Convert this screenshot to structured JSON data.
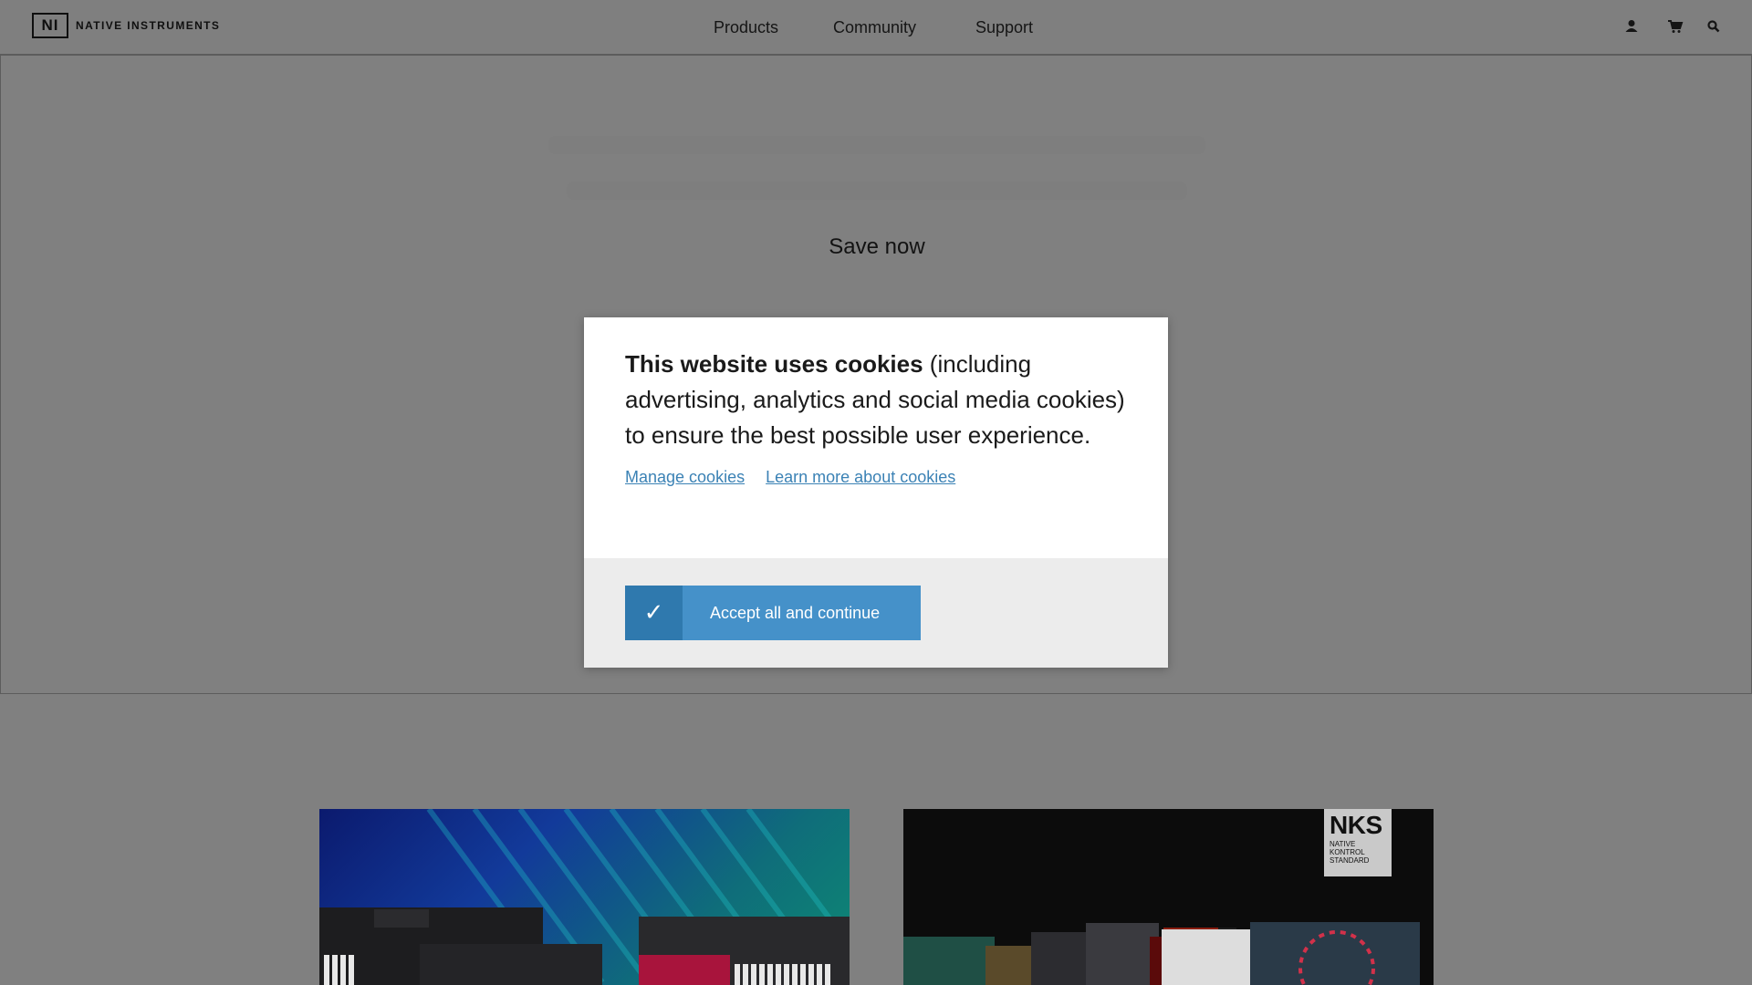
{
  "header": {
    "logo_mark": "NI",
    "logo_text": "NATIVE INSTRUMENTS",
    "nav": {
      "products": "Products",
      "community": "Community",
      "support": "Support"
    },
    "icons": {
      "account": "user-icon",
      "cart": "cart-icon",
      "search": "search-icon"
    }
  },
  "hero": {
    "cta": "Save now"
  },
  "cards": {
    "right_badge_title": "NKS",
    "right_badge_sub": "NATIVE KONTROL STANDARD"
  },
  "cookie_modal": {
    "title_bold": "This website uses cookies",
    "title_rest": " (including advertising, analytics and social media cookies) to ensure the best possible user experience.",
    "manage_link": "Manage cookies",
    "learn_link": "Learn more about cookies",
    "accept_check": "✓",
    "accept_label": "Accept all and continue"
  },
  "colors": {
    "overlay_bg": "#808080",
    "accent": "#4591c9",
    "accent_dark": "#2f79ae",
    "link": "#3b82b5"
  }
}
